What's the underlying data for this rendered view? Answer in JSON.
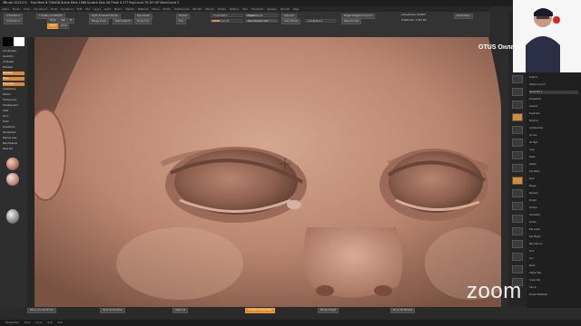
{
  "app": {
    "title": "ZBrush 2023.0.0",
    "doc_info": "Free Mem 8.7264GB  Active Mem 1988  Scratch Disk 48  Timer 0.177  PolyCount 79.207 KP  MeshCount 2",
    "right_title": "QuickSave"
  },
  "menus": [
    "Alpha",
    "Brush",
    "Color",
    "Document",
    "Draw",
    "Dynamics",
    "Edit",
    "File",
    "Layer",
    "Light",
    "Macro",
    "Marker",
    "Material",
    "Movie",
    "Picker",
    "Preferences",
    "Render",
    "Stencil",
    "Stroke",
    "Texture",
    "Tool",
    "Transform",
    "Zplugin",
    "Zscript",
    "Help"
  ],
  "topshelf": {
    "x_position": "X Position 0",
    "y_position": "Y Position 0.005453",
    "z_position": "Z Position 0",
    "focal_shift": "Focal Shift 0",
    "draw_size": "Draw Size 64",
    "dynamic": "Dynamic",
    "active_points": "ActivePoints: 50,883",
    "total_points": "TotalPoints: 1.692 Mil",
    "lazy_mouse": "Lazy Mouse",
    "lazy_radius": "LazyRadius 1",
    "intensity": "Z Intensity 25",
    "rgb_intensity": "Rgb Intensity 100",
    "mrgb": "Mrgb",
    "rgb": "Rgb",
    "m": "M",
    "zadd": "Zadd",
    "zsub": "Zsub",
    "split_unmasked": "Split Unmasked Points",
    "merge_down": "Merge Down",
    "new_sub": "New Subtool",
    "dynamesh": "Dynamesh",
    "project_all": "Project All",
    "double": "Double",
    "flip": "Flip",
    "target_polygons": "Target Polygons Count 5",
    "keep_groups": "Keep Groups",
    "quick_save": "Quick Save"
  },
  "left_panel": {
    "items": [
      "Live Boolean",
      "Geometry",
      "UV Master",
      "ZModeler",
      "Standard",
      "Move",
      "Move Topo",
      "ClayBuildup",
      "hPolish",
      "TrimDynamic",
      "DamStandard",
      "Inflat",
      "Pinch",
      "Polish",
      "SnakeHook",
      "SkinShade4",
      "MatCap Gray",
      "BasicMaterial",
      "Mask Pen"
    ]
  },
  "right_panel": {
    "items": [
      "Subtool",
      "Visible Count 2",
      "Sphere3D_1",
      "Polysphere",
      "Append",
      "Duplicate",
      "Rename",
      "AutoReorder",
      "All Low",
      "All High",
      "Copy",
      "Paste",
      "Delete",
      "Del Other",
      "Split",
      "Merge",
      "Remesh",
      "Project",
      "Extract",
      "Geometry",
      "Divide",
      "Del Lower",
      "Del Higher",
      "Reconstruct",
      "Smt",
      "Suv",
      "ReUV",
      "Higher Res",
      "Lower Res",
      "Sdiv 6",
      "Project BasRelief"
    ],
    "labels": [
      "BPR",
      "SPix 3",
      "Scroll",
      "Zoom",
      "Actual",
      "AAHalf",
      "Persp",
      "Floor",
      "Local",
      "Frame",
      "Move",
      "Scale",
      "Rotate",
      "Transp",
      "Ghost",
      "Solo",
      "Xpose"
    ]
  },
  "bottom": {
    "items": [
      "Store Current Brush",
      "Save All Brushes",
      "Apply all",
      "Configure Properties",
      "Morph Target",
      "Move All Morphs"
    ],
    "status": [
      "Perspective",
      "Floor",
      "Lsym",
      "XYZ",
      "Solo"
    ]
  },
  "overlay": {
    "channel": "OTUS Онлайн",
    "zoom_logo": "zoom"
  },
  "colors": {
    "accent": "#e08a2c",
    "ui_bg": "#2b2b2b",
    "skin": "#c0907a",
    "webcam_bg": "#ffffff"
  }
}
